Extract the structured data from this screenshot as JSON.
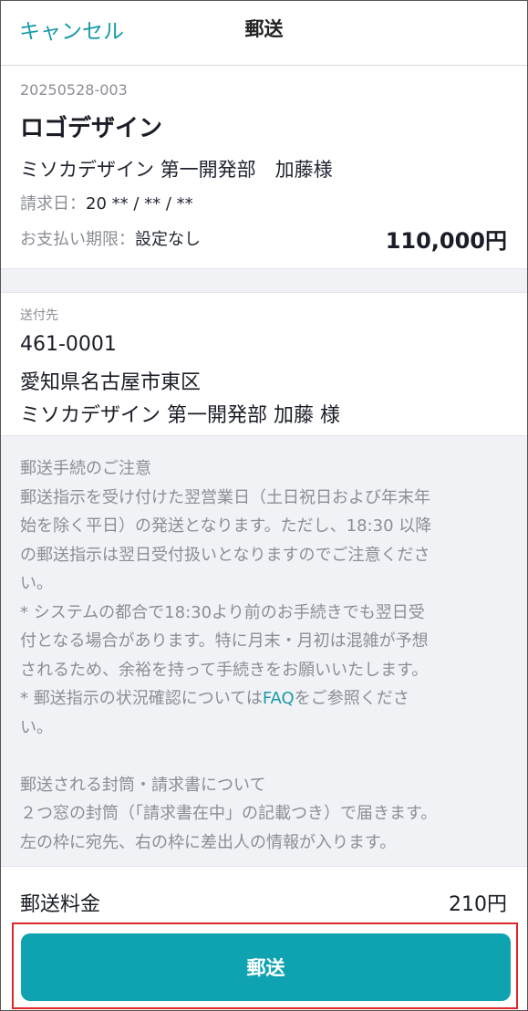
{
  "header": {
    "cancel_label": "キャンセル",
    "title": "郵送"
  },
  "invoice": {
    "number": "20250528-003",
    "title": "ロゴデザイン",
    "client": "ミソカデザイン 第一開発部　加藤様",
    "date_label": "請求日：",
    "date_value": "20 ** / ** / **",
    "due_label": "お支払い期限：",
    "due_value": "設定なし",
    "amount": "110,000円"
  },
  "destination": {
    "label": "送付先",
    "zip": "461-0001",
    "address": "愛知県名古屋市東区",
    "name": "ミソカデザイン  第一開発部 加藤 様"
  },
  "notes": {
    "heading": "郵送手続のご注意",
    "line1": "郵送指示を受け付けた翌営業日（土日祝日および年末年",
    "line2": "始を除く平日）の発送となります。ただし、18:30 以降",
    "line3": "の郵送指示は翌日受付扱いとなりますのでご注意くださ",
    "line4": "い。",
    "line5": "* システムの都合で18:30より前のお手続きでも翌日受",
    "line6": "付となる場合があります。特に月末・月初は混雑が予想",
    "line7": "されるため、余裕を持って手続きをお願いいたします。",
    "line8_pre": "* 郵送指示の状況確認については",
    "faq_link": "FAQ",
    "line8_post": "をご参照くださ",
    "line9": "い。",
    "envelope_heading": "郵送される封筒・請求書について",
    "env_line1": "２つ窓の封筒（「請求書在中」の記載つき）で届きます。",
    "env_line2": "左の枠に宛先、右の枠に差出人の情報が入ります。"
  },
  "fee": {
    "label": "郵送料金",
    "value": "210円"
  },
  "send_button": {
    "label": "郵送"
  },
  "colors": {
    "accent": "#0fa3b1",
    "link": "#1a9aa8",
    "highlight_border": "#e0262b",
    "muted_text": "#8b8e96",
    "section_bg": "#f1f2f6"
  }
}
